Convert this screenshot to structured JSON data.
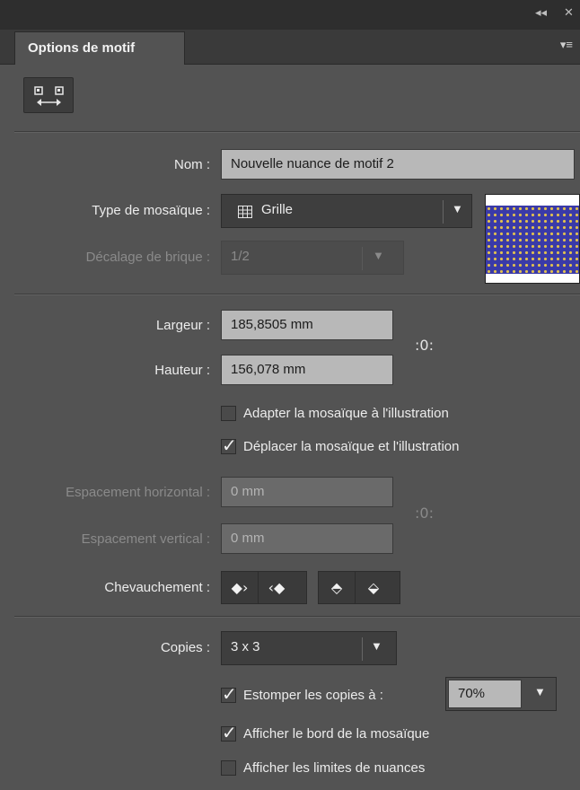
{
  "window": {
    "collapse_icon": "double-chevron-left-icon",
    "close_icon": "close-icon"
  },
  "panel": {
    "tab_label": "Options de motif",
    "menu_icon": "panel-menu-icon",
    "tool_icon": "pattern-tile-tool-icon"
  },
  "name_row": {
    "label": "Nom :",
    "value": "Nouvelle nuance de motif 2"
  },
  "tile_type": {
    "label": "Type de mosaïque :",
    "value": "Grille",
    "icon": "grid-icon"
  },
  "brick_offset": {
    "label": "Décalage de brique :",
    "value": "1/2",
    "disabled": true
  },
  "width": {
    "label": "Largeur :",
    "value": "185,8505 mm"
  },
  "height": {
    "label": "Hauteur :",
    "value": "156,078 mm"
  },
  "checkboxes_size": [
    {
      "label": "Adapter la mosaïque à l'illustration",
      "checked": false
    },
    {
      "label": "Déplacer la mosaïque et l'illustration",
      "checked": true
    }
  ],
  "h_spacing": {
    "label": "Espacement horizontal :",
    "value": "0 mm",
    "disabled": true
  },
  "v_spacing": {
    "label": "Espacement vertical :",
    "value": "0 mm",
    "disabled": true
  },
  "overlap": {
    "label": "Chevauchement :",
    "buttons": [
      "left-in-front-icon",
      "right-in-front-icon",
      "top-in-front-icon",
      "bottom-in-front-icon"
    ]
  },
  "copies": {
    "label": "Copies :",
    "value": "3 x 3"
  },
  "dim_copies": {
    "label": "Estomper les copies à :",
    "checked": true,
    "value": "70%"
  },
  "checkboxes_display": [
    {
      "label": "Afficher le bord de la mosaïque",
      "checked": true
    },
    {
      "label": "Afficher les limites de nuances",
      "checked": false
    }
  ],
  "colors": {
    "panel_bg": "#535353",
    "field_bg": "#b8b8b8",
    "preview_fill": "#3a3aa8",
    "preview_dots": "#e0c050"
  }
}
